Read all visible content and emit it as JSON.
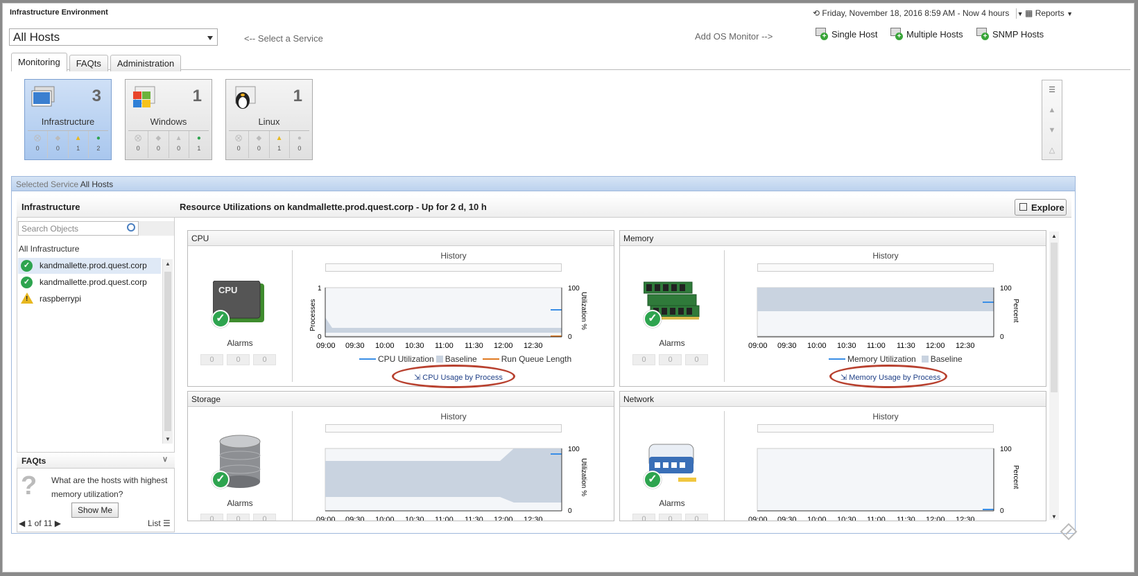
{
  "header": {
    "title": "Infrastructure Environment",
    "timerange": "Friday, November 18, 2016 8:59 AM - Now 4 hours",
    "reports": "Reports"
  },
  "host_select": {
    "value": "All Hosts"
  },
  "select_service_hint": "<-- Select a Service",
  "add_os_monitor": "Add OS Monitor -->",
  "add_buttons": {
    "single": "Single Host",
    "multiple": "Multiple Hosts",
    "snmp": "SNMP Hosts"
  },
  "tabs": [
    "Monitoring",
    "FAQts",
    "Administration"
  ],
  "cards": [
    {
      "label": "Infrastructure",
      "count": "3",
      "stats": [
        "0",
        "0",
        "1",
        "2"
      ]
    },
    {
      "label": "Windows",
      "count": "1",
      "stats": [
        "0",
        "0",
        "0",
        "1"
      ]
    },
    {
      "label": "Linux",
      "count": "1",
      "stats": [
        "0",
        "0",
        "1",
        "0"
      ]
    }
  ],
  "service_bar": {
    "prefix": "Selected Service",
    "value": "All Hosts"
  },
  "left": {
    "title": "Infrastructure",
    "search_placeholder": "Search Objects",
    "root": "All Infrastructure",
    "items": [
      "kandmallette.prod.quest.corp",
      "kandmallette.prod.quest.corp",
      "raspberrypi"
    ],
    "faq_title": "FAQts",
    "faq_question": "What are the hosts with highest memory utilization?",
    "show_me": "Show Me",
    "pager": "1 of 11",
    "list": "List"
  },
  "main": {
    "title": "Resource Utilizations on kandmallette.prod.quest.corp - Up for 2 d, 10 h",
    "explore": "Explore"
  },
  "panels": {
    "cpu": {
      "title": "CPU",
      "alarms": "Alarms",
      "alarm_counts": [
        "0",
        "0",
        "0"
      ],
      "history": "History",
      "left_axis": "Processes",
      "right_axis": "Utilization %",
      "legend": [
        "CPU Utilization",
        "Baseline",
        "Run Queue Length"
      ],
      "button": "CPU Usage by Process",
      "icon_text": "CPU"
    },
    "memory": {
      "title": "Memory",
      "alarms": "Alarms",
      "alarm_counts": [
        "0",
        "0",
        "0"
      ],
      "history": "History",
      "right_axis": "Percent",
      "legend": [
        "Memory Utilization",
        "Baseline"
      ],
      "button": "Memory Usage by Process"
    },
    "storage": {
      "title": "Storage",
      "alarms": "Alarms",
      "alarm_counts": [
        "0",
        "0",
        "0"
      ],
      "history": "History",
      "right_axis": "Utilization %"
    },
    "network": {
      "title": "Network",
      "alarms": "Alarms",
      "alarm_counts": [
        "0",
        "0",
        "0"
      ],
      "history": "History",
      "right_axis": "Percent"
    }
  },
  "time_ticks": [
    "09:00",
    "09:30",
    "10:00",
    "10:30",
    "11:00",
    "11:30",
    "12:00",
    "12:30"
  ],
  "colors": {
    "accent_blue": "#3a8ee6",
    "baseline": "#c9d3e0",
    "orange": "#e07a22",
    "ok": "#2ea44f",
    "warn": "#e8b820",
    "ring": "#b8412f"
  }
}
